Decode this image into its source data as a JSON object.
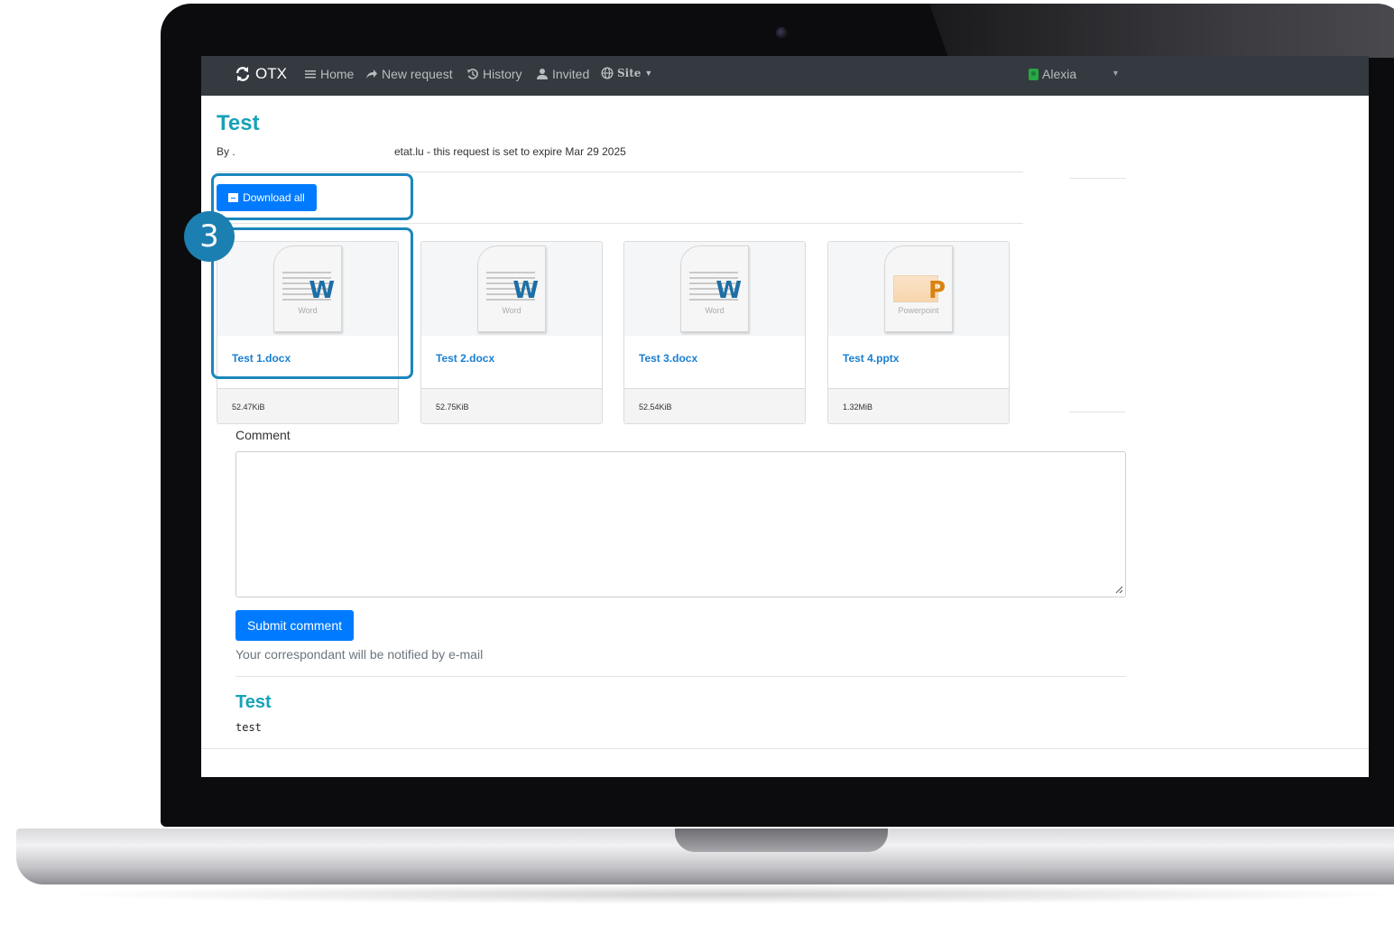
{
  "navbar": {
    "brand": "OTX",
    "items": [
      {
        "label": "Home",
        "icon": "menu-icon"
      },
      {
        "label": "New request",
        "icon": "share-arrow-icon"
      },
      {
        "label": "History",
        "icon": "history-icon"
      },
      {
        "label": "Invited",
        "icon": "user-icon"
      },
      {
        "label": "Site",
        "icon": "globe-icon"
      }
    ],
    "user": "Alexia"
  },
  "request": {
    "title": "Test",
    "by_prefix": "By .",
    "by_suffix": "etat.lu - this request is set to expire Mar 29 2025"
  },
  "download_all": "Download all",
  "callout_number": "3",
  "files": [
    {
      "name": "Test 1.docx",
      "size": "52.47KiB",
      "type": "Word",
      "letter": "W",
      "color": "#1d6fa5"
    },
    {
      "name": "Test 2.docx",
      "size": "52.75KiB",
      "type": "Word",
      "letter": "W",
      "color": "#1d6fa5"
    },
    {
      "name": "Test 3.docx",
      "size": "52.54KiB",
      "type": "Word",
      "letter": "W",
      "color": "#1d6fa5"
    },
    {
      "name": "Test 4.pptx",
      "size": "1.32MiB",
      "type": "Powerpoint",
      "letter": "P",
      "color": "#d9820f"
    }
  ],
  "comment": {
    "label": "Comment",
    "value": "",
    "submit": "Submit comment",
    "notice": "Your correspondant will be notified by e-mail"
  },
  "comments_section": {
    "title": "Test",
    "body": "test"
  },
  "colors": {
    "navbar": "#343a40",
    "primary": "#007bff",
    "heading": "#17a2b8",
    "callout": "#1b86bd"
  }
}
